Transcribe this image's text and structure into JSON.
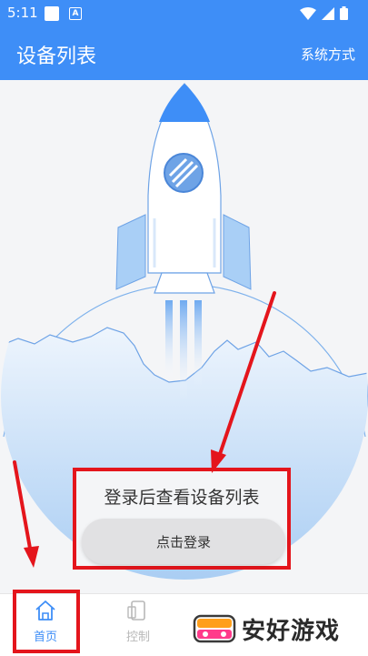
{
  "status_bar": {
    "time": "5:11"
  },
  "app_bar": {
    "title": "设备列表",
    "action_label": "系统方式"
  },
  "login": {
    "prompt": "登录后查看设备列表",
    "button_label": "点击登录"
  },
  "tabs": [
    {
      "label": "首页",
      "icon": "home-icon",
      "active": true
    },
    {
      "label": "控制",
      "icon": "phone-icon",
      "active": false
    }
  ],
  "watermark": {
    "text": "安好游戏"
  },
  "colors": {
    "primary": "#3e8ef7",
    "annotation": "#e4151c",
    "background": "#f4f5f7"
  }
}
